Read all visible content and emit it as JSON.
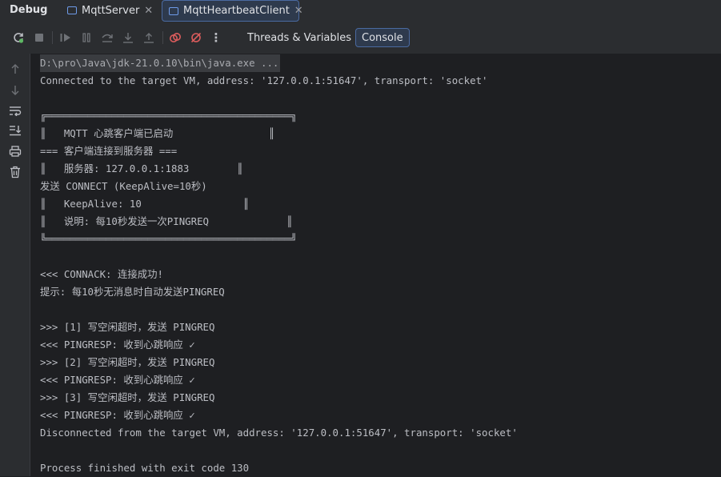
{
  "window": {
    "title": "Debug"
  },
  "tabs": [
    {
      "label": "MqttServer",
      "active": false
    },
    {
      "label": "MqttHeartbeatClient",
      "active": true
    }
  ],
  "toolbar": {
    "icons": [
      "rerun-icon",
      "stop-icon",
      "resume-icon",
      "pause-icon",
      "step-over-icon",
      "step-into-icon",
      "step-out-icon",
      "view-breakpoints-icon",
      "mute-breakpoints-icon",
      "more-icon"
    ],
    "threads_label": "Threads & Variables",
    "console_label": "Console",
    "more_label": "⋮"
  },
  "gutter": {
    "icons": [
      "up-arrow-icon",
      "down-arrow-icon",
      "soft-wrap-icon",
      "scroll-to-end-icon",
      "print-icon",
      "clear-icon"
    ]
  },
  "console": {
    "command": "D:\\pro\\Java\\jdk-21.0.10\\bin\\java.exe ...",
    "lines": [
      "Connected to the target VM, address: '127.0.0.1:51647', transport: 'socket'",
      "",
      "╔═════════════════════════════════════════╗",
      "║   MQTT 心跳客户端已启动                ║",
      "=== 客户端连接到服务器 ===",
      "║   服务器: 127.0.0.1:1883        ║",
      "发送 CONNECT (KeepAlive=10秒)",
      "║   KeepAlive: 10                 ║",
      "║   说明: 每10秒发送一次PINGREQ             ║",
      "╚═════════════════════════════════════════╝",
      "",
      "<<< CONNACK: 连接成功!",
      "提示: 每10秒无消息时自动发送PINGREQ",
      "",
      ">>> [1] 写空闲超时，发送 PINGREQ",
      "<<< PINGRESP: 收到心跳响应 ✓",
      ">>> [2] 写空闲超时，发送 PINGREQ",
      "<<< PINGRESP: 收到心跳响应 ✓",
      ">>> [3] 写空闲超时，发送 PINGREQ",
      "<<< PINGRESP: 收到心跳响应 ✓",
      "Disconnected from the target VM, address: '127.0.0.1:51647', transport: 'socket'",
      "",
      "Process finished with exit code 130"
    ]
  },
  "colors": {
    "background": "#1e1f22",
    "panel": "#2b2d30",
    "accent": "#4a6aa1",
    "rerun_green": "#5fb865",
    "breakpoint_red": "#db5c5c"
  }
}
